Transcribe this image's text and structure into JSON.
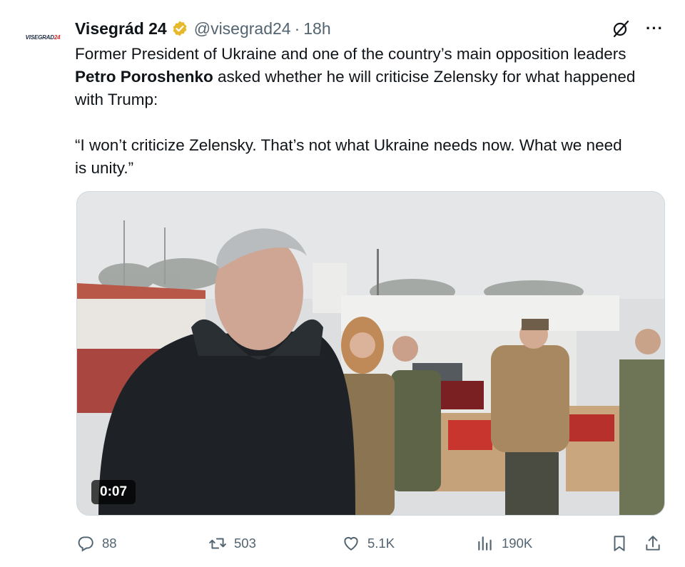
{
  "account": {
    "avatar_text_main": "VISEGRAD",
    "avatar_text_num": "24",
    "name": "Visegrád 24",
    "handle": "@visegrad24",
    "separator": "·",
    "time": "18h"
  },
  "tweet": {
    "line1_text": "Former President of Ukraine and one of the country’s main opposition leaders",
    "bold_name": "Petro Poroshenko",
    "line2_rest": " asked whether he will criticise Zelensky for what happened",
    "line3": "with Trump:",
    "quote_line1": "“I won’t criticize Zelensky. That’s not what Ukraine needs now. What we need",
    "quote_line2": "is unity.”"
  },
  "media": {
    "duration": "0:07"
  },
  "actions": {
    "replies": "88",
    "reposts": "503",
    "likes": "5.1K",
    "views": "190K"
  },
  "colors": {
    "text_primary": "#0f1419",
    "text_secondary": "#536471",
    "verified_gold": "#e8b82b"
  },
  "icons": [
    "grok-icon",
    "more-icon",
    "verified-icon",
    "reply-icon",
    "repost-icon",
    "like-icon",
    "views-icon",
    "bookmark-icon",
    "share-icon"
  ]
}
